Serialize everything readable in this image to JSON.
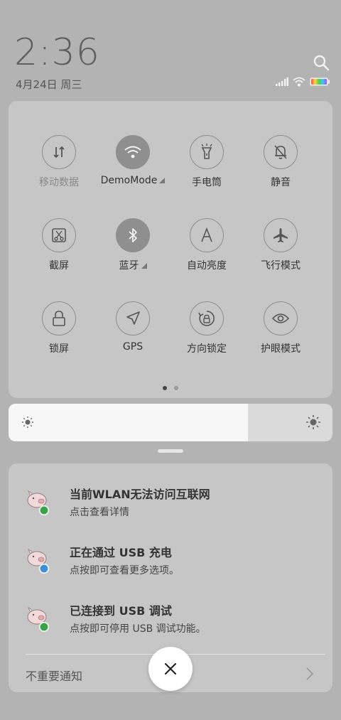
{
  "status": {
    "time": "2:36",
    "date": "4月24日 周三"
  },
  "quick_settings": {
    "tiles": [
      {
        "label": "移动数据",
        "icon": "mobile-data-icon",
        "active": false,
        "dim": true
      },
      {
        "label": "DemoMode",
        "icon": "wifi-icon",
        "active": true,
        "expandable": true
      },
      {
        "label": "手电筒",
        "icon": "flashlight-icon",
        "active": false
      },
      {
        "label": "静音",
        "icon": "mute-bell-icon",
        "active": false
      },
      {
        "label": "截屏",
        "icon": "screenshot-icon",
        "active": false
      },
      {
        "label": "蓝牙",
        "icon": "bluetooth-icon",
        "active": true,
        "expandable": true
      },
      {
        "label": "自动亮度",
        "icon": "auto-brightness-icon",
        "active": false
      },
      {
        "label": "飞行模式",
        "icon": "airplane-icon",
        "active": false
      },
      {
        "label": "锁屏",
        "icon": "lock-icon",
        "active": false
      },
      {
        "label": "GPS",
        "icon": "gps-icon",
        "active": false
      },
      {
        "label": "方向锁定",
        "icon": "rotation-lock-icon",
        "active": false
      },
      {
        "label": "护眼模式",
        "icon": "eye-icon",
        "active": false
      }
    ],
    "page": 1,
    "pages": 2
  },
  "brightness": {
    "level": 0.74
  },
  "notifications": [
    {
      "title": "当前WLAN无法访问互联网",
      "body": "点击查看详情",
      "badge_color": "#3aa34a"
    },
    {
      "title": "正在通过 USB 充电",
      "body": "点按即可查看更多选项。",
      "badge_color": "#3f8fd8"
    },
    {
      "title": "已连接到 USB 调试",
      "body": "点按即可停用 USB 调试功能。",
      "badge_color": "#3aa34a"
    }
  ],
  "footer": {
    "less_important_label": "不重要通知"
  },
  "colors": {
    "background": "#b3b3b3",
    "panel": "#c6c6c6",
    "active_tile": "#8f8f8f"
  }
}
